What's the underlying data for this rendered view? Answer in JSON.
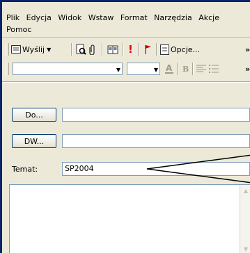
{
  "menu": {
    "items": [
      "Plik",
      "Edycja",
      "Widok",
      "Wstaw",
      "Format",
      "Narzędzia",
      "Akcje"
    ],
    "row2": "Pomoc"
  },
  "toolbar1": {
    "send_label": "Wyślij",
    "options_label": "Opcje...",
    "overflow": "»"
  },
  "toolbar2": {
    "overflow": "»"
  },
  "fields": {
    "to_label": "Do...",
    "cc_label": "DW...",
    "subject_label": "Temat:",
    "subject_value": "SP2004"
  },
  "colors": {
    "frame": "#0a246a",
    "chrome": "#ece9d8",
    "annotation": "#000000"
  }
}
